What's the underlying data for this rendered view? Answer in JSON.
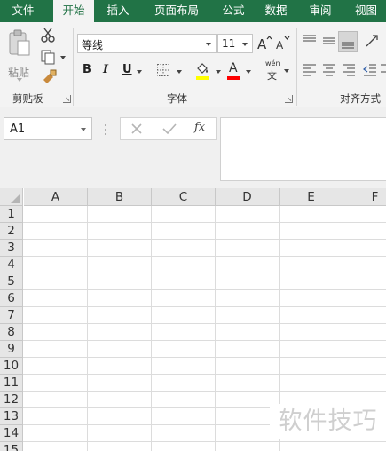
{
  "tabs": [
    {
      "label": "文件"
    },
    {
      "label": "开始"
    },
    {
      "label": "插入"
    },
    {
      "label": "页面布局"
    },
    {
      "label": "公式"
    },
    {
      "label": "数据"
    },
    {
      "label": "审阅"
    },
    {
      "label": "视图"
    }
  ],
  "active_tab": "开始",
  "ribbon": {
    "clipboard": {
      "label": "剪贴板",
      "paste_label": "粘贴"
    },
    "font": {
      "label": "字体",
      "font_name": "等线",
      "font_size": "11",
      "bold": "B",
      "italic": "I",
      "underline": "U",
      "font_color_glyph": "A",
      "phonetic_top": "wén",
      "phonetic_bottom": "文"
    },
    "alignment": {
      "label": "对齐方式"
    }
  },
  "formula_bar": {
    "name_box": "A1",
    "function_label": "fx",
    "formula_value": ""
  },
  "sheet": {
    "columns": [
      "A",
      "B",
      "C",
      "D",
      "E",
      "F"
    ],
    "rows": [
      "1",
      "2",
      "3",
      "4",
      "5",
      "6",
      "7",
      "8",
      "9",
      "10",
      "11",
      "12",
      "13",
      "14",
      "15"
    ]
  },
  "watermark": "软件技巧",
  "colors": {
    "accent": "#217346",
    "fill_highlight": "#ffff00",
    "font_color": "#ff0000"
  }
}
